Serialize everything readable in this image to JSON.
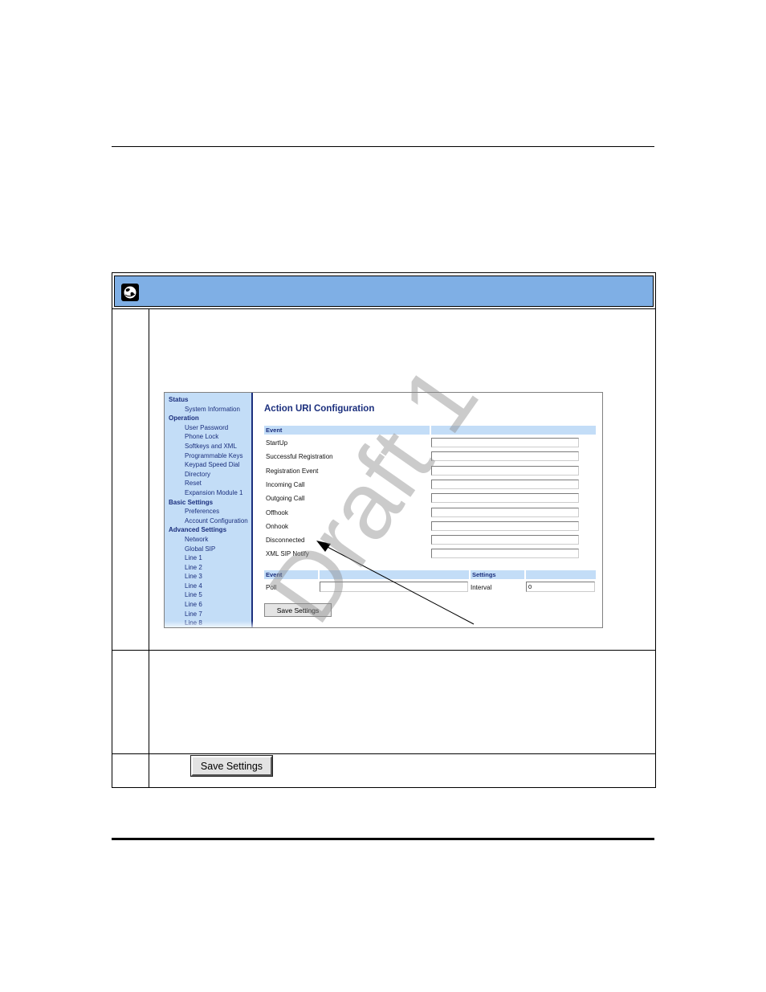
{
  "screenshot": {
    "nav": [
      {
        "group": "Status",
        "items": [
          "System Information"
        ]
      },
      {
        "group": "Operation",
        "items": [
          "User Password",
          "Phone Lock",
          "Softkeys and XML",
          "Programmable Keys",
          "Keypad Speed Dial",
          "Directory",
          "Reset",
          "Expansion Module 1"
        ]
      },
      {
        "group": "Basic Settings",
        "items": [
          "Preferences",
          "Account Configuration"
        ]
      },
      {
        "group": "Advanced Settings",
        "items": [
          "Network",
          "Global SIP",
          "Line 1",
          "Line 2",
          "Line 3",
          "Line 4",
          "Line 5",
          "Line 6",
          "Line 7",
          "Line 8"
        ]
      }
    ],
    "title": "Action URI Configuration",
    "event_header": "Event",
    "events": [
      "StartUp",
      "Successful Registration",
      "Registration Event",
      "Incoming Call",
      "Outgoing Call",
      "Offhook",
      "Onhook",
      "Disconnected",
      "XML SIP Notify"
    ],
    "poll_section": {
      "event_header": "Event",
      "settings_header": "Settings",
      "poll_label": "Poll",
      "interval_label": "Interval",
      "interval_value": "0"
    },
    "save_button": "Save Settings"
  },
  "step_save_button": "Save Settings",
  "watermark": "Draft 1",
  "colors": {
    "header_band": "#7fafe5",
    "nav_background": "#c3ddf7",
    "nav_text": "#1b2f7d"
  },
  "icons": {
    "header": "globe-icon"
  }
}
